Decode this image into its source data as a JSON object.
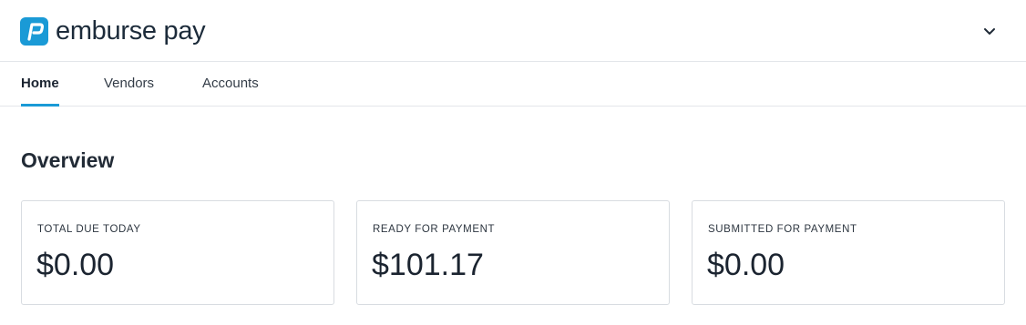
{
  "header": {
    "brand": "emburse pay",
    "account_menu_icon": "chevron-down-icon",
    "logo_icon": "emburse-logo-icon",
    "brand_color": "#1a9ad6"
  },
  "tabs": [
    {
      "label": "Home",
      "active": true
    },
    {
      "label": "Vendors",
      "active": false
    },
    {
      "label": "Accounts",
      "active": false
    }
  ],
  "main": {
    "title": "Overview",
    "cards": [
      {
        "label": "TOTAL DUE TODAY",
        "value": "$0.00"
      },
      {
        "label": "READY FOR PAYMENT",
        "value": "$101.17"
      },
      {
        "label": "SUBMITTED FOR PAYMENT",
        "value": "$0.00"
      }
    ]
  }
}
